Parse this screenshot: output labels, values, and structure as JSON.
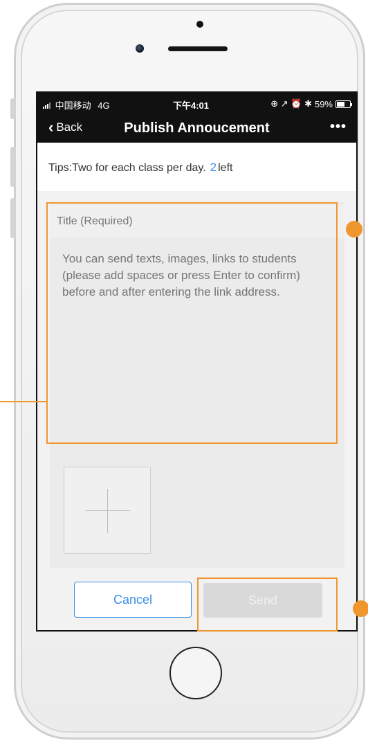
{
  "status_bar": {
    "carrier": "中国移动",
    "network": "4G",
    "time": "下午4:01",
    "icons": "⊕ ↗ ⏰ ✱",
    "battery": "59%"
  },
  "nav": {
    "back_label": "Back",
    "title": "Publish Annoucement",
    "more_label": "•••"
  },
  "tips": {
    "prefix": "Tips:Two for each class per day.",
    "count": "2",
    "suffix": "left"
  },
  "form": {
    "title_placeholder": "Title (Required)",
    "body_placeholder": "You can send texts, images, links to students (please add spaces or press Enter to confirm) before and after entering the link address.",
    "add_image_icon": "plus-icon"
  },
  "actions": {
    "cancel_label": "Cancel",
    "send_label": "Send"
  },
  "colors": {
    "accent": "#3a8ee6",
    "annotation": "#f0962e",
    "bar": "#111111"
  }
}
